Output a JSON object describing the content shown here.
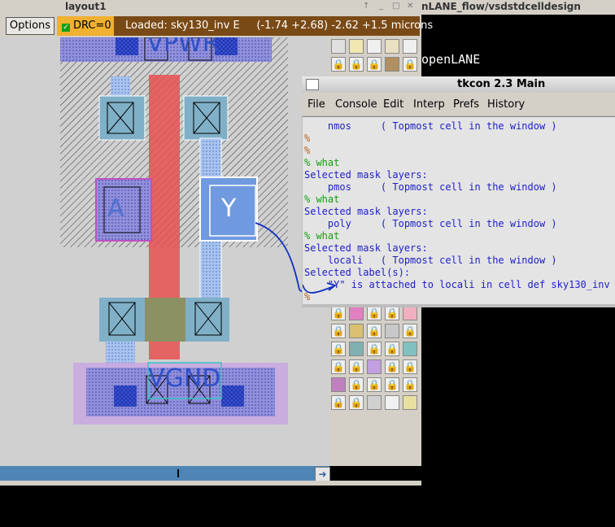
{
  "layout_window": {
    "title": "layout1",
    "options_label": "Options",
    "drc_label": "DRC=0",
    "status": "Loaded: sky130_inv E     (-1.74 +2.68) -2.62 +1.5 microns"
  },
  "terminal_window": {
    "title": "nLANE_flow/vsdstdcelldesign",
    "text": "openLANE"
  },
  "layout_labels": {
    "vpwr": "VPWR",
    "a": "A",
    "y": "Y",
    "vgnd": "VGND"
  },
  "tkcon": {
    "title": "tkcon 2.3 Main",
    "menus": [
      "File",
      "Console",
      "Edit",
      "Interp",
      "Prefs",
      "History"
    ],
    "lines": [
      {
        "cls": "out",
        "text": "    nmos     ( Topmost cell in the window )"
      },
      {
        "cls": "prm",
        "text": "%"
      },
      {
        "cls": "prm",
        "text": "%"
      },
      {
        "cls": "cmd",
        "text": "% what"
      },
      {
        "cls": "out",
        "text": "Selected mask layers:"
      },
      {
        "cls": "out",
        "text": "    pmos     ( Topmost cell in the window )"
      },
      {
        "cls": "cmd",
        "text": "% what"
      },
      {
        "cls": "out",
        "text": "Selected mask layers:"
      },
      {
        "cls": "out",
        "text": "    poly     ( Topmost cell in the window )"
      },
      {
        "cls": "cmd",
        "text": "% what"
      },
      {
        "cls": "out",
        "text": "Selected mask layers:"
      },
      {
        "cls": "out",
        "text": "    locali   ( Topmost cell in the window )"
      },
      {
        "cls": "out",
        "text": "Selected label(s):"
      },
      {
        "cls": "out",
        "text": "    \"Y\" is attached to locali in cell def sky130_inv"
      },
      {
        "cls": "prm",
        "text": "%"
      }
    ]
  },
  "colors": {
    "status_bg": "#7a4a16",
    "drc_bg": "#f0b030",
    "poly": "#e85050",
    "locali": "#8ab0e8",
    "nwell": "#b0b0e0",
    "diff": "#80c0c0",
    "console_text": "#2020c8",
    "console_cmd": "#14a014"
  }
}
